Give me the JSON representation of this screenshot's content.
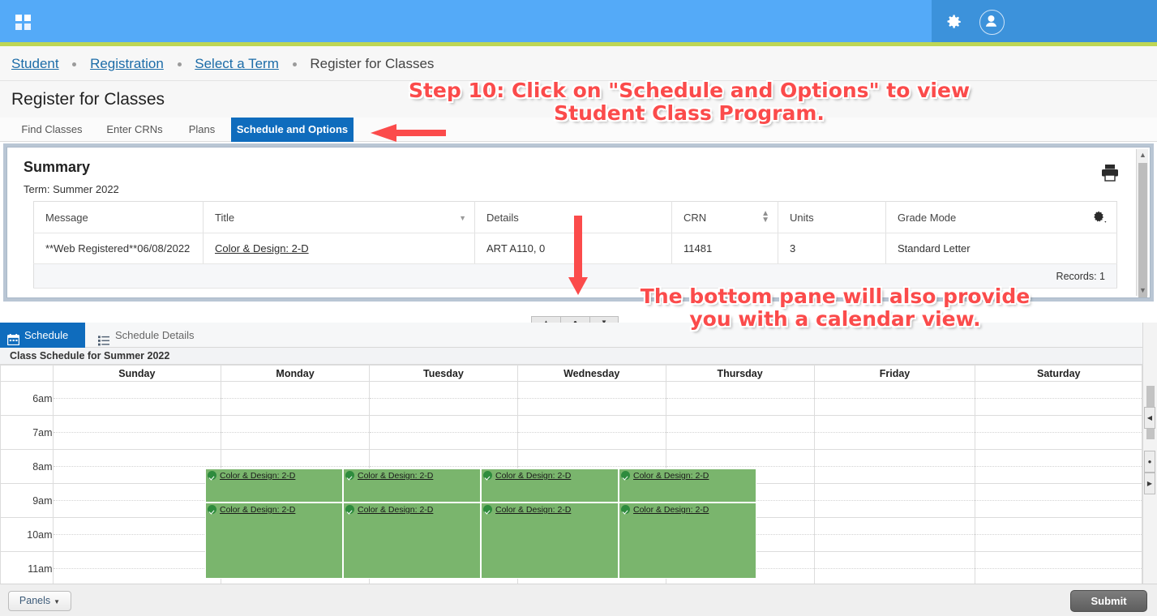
{
  "topbar": {
    "app_grid_icon": "apps-grid-icon",
    "gear_icon": "gear-icon",
    "avatar_icon": "user-avatar-icon",
    "brand_blue": "#54aaf8",
    "accent_lime": "#bed654"
  },
  "breadcrumb": {
    "items": [
      {
        "label": "Student",
        "link": true
      },
      {
        "label": "Registration",
        "link": true
      },
      {
        "label": "Select a Term",
        "link": true
      },
      {
        "label": "Register for Classes",
        "link": false
      }
    ]
  },
  "page": {
    "title": "Register for Classes"
  },
  "tabs": [
    {
      "label": "Find Classes",
      "active": false
    },
    {
      "label": "Enter CRNs",
      "active": false
    },
    {
      "label": "Plans",
      "active": false
    },
    {
      "label": "Schedule and Options",
      "active": true
    }
  ],
  "summary": {
    "heading": "Summary",
    "term_label": "Term:",
    "term_value": "Summer 2022",
    "print_icon": "printer-icon",
    "settings_icon": "gear-icon",
    "columns": [
      "Message",
      "Title",
      "Details",
      "CRN",
      "Units",
      "Grade Mode"
    ],
    "rows": [
      {
        "message": "**Web Registered**06/08/2022",
        "title": "Color & Design: 2-D",
        "details": "ART A110, 0",
        "crn": "11481",
        "units": "3",
        "grade_mode": "Standard Letter"
      }
    ],
    "records_label": "Records: 1"
  },
  "divider": {
    "collapse_up": "▲",
    "restore": "●",
    "collapse_down": "▼"
  },
  "bottom_pane": {
    "tabs": [
      {
        "label": "Schedule",
        "icon": "calendar-icon",
        "active": true
      },
      {
        "label": "Schedule Details",
        "icon": "list-icon",
        "active": false
      }
    ],
    "caption": "Class Schedule for Summer 2022"
  },
  "calendar": {
    "days": [
      "Sunday",
      "Monday",
      "Tuesday",
      "Wednesday",
      "Thursday",
      "Friday",
      "Saturday"
    ],
    "times": [
      "6am",
      "7am",
      "8am",
      "9am",
      "10am",
      "11am"
    ],
    "event_color": "#7ab56d",
    "check_icon": "check-circle-icon",
    "events": [
      {
        "day": "Monday",
        "label": "Color & Design: 2-D",
        "block": 1
      },
      {
        "day": "Tuesday",
        "label": "Color & Design: 2-D",
        "block": 1
      },
      {
        "day": "Wednesday",
        "label": "Color & Design: 2-D",
        "block": 1
      },
      {
        "day": "Thursday",
        "label": "Color & Design: 2-D",
        "block": 1
      },
      {
        "day": "Monday",
        "label": "Color & Design: 2-D",
        "block": 2
      },
      {
        "day": "Tuesday",
        "label": "Color & Design: 2-D",
        "block": 2
      },
      {
        "day": "Wednesday",
        "label": "Color & Design: 2-D",
        "block": 2
      },
      {
        "day": "Thursday",
        "label": "Color & Design: 2-D",
        "block": 2
      }
    ]
  },
  "footer": {
    "panels_label": "Panels",
    "panels_caret": "▼",
    "submit_label": "Submit"
  },
  "annotations": {
    "note1_line1": "Step 10: Click on \"Schedule and Options\" to view",
    "note1_line2": "Student Class Program.",
    "note2_line1": "The bottom pane will also provide",
    "note2_line2": "you with a calendar view.",
    "color": "#fb4b4b"
  }
}
